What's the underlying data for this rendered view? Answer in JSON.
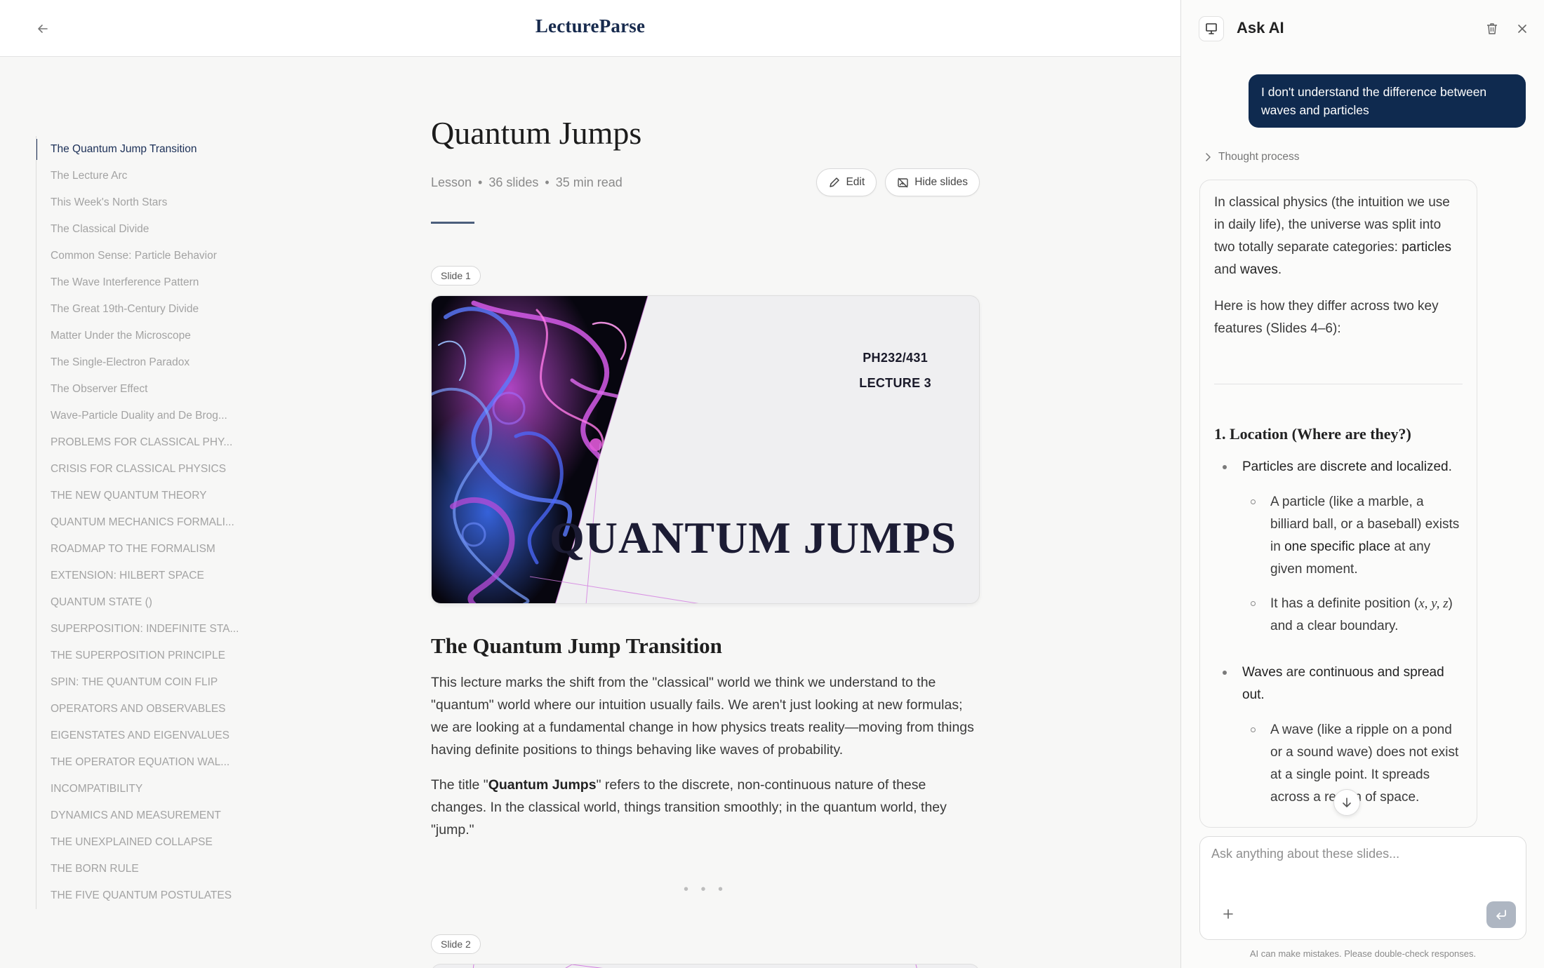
{
  "app": {
    "brand": "LectureParse"
  },
  "toc": {
    "items": [
      "The Quantum Jump Transition",
      "The Lecture Arc",
      "This Week's North Stars",
      "The Classical Divide",
      "Common Sense: Particle Behavior",
      "The Wave Interference Pattern",
      "The Great 19th-Century Divide",
      "Matter Under the Microscope",
      "The Single-Electron Paradox",
      "The Observer Effect",
      "Wave-Particle Duality and De Brog...",
      "PROBLEMS FOR CLASSICAL PHY...",
      "CRISIS FOR CLASSICAL PHYSICS",
      "THE NEW QUANTUM THEORY",
      "QUANTUM MECHANICS FORMALI...",
      "ROADMAP TO THE FORMALISM",
      "EXTENSION: HILBERT SPACE",
      "QUANTUM STATE ()",
      "SUPERPOSITION: INDEFINITE STA...",
      "THE SUPERPOSITION PRINCIPLE",
      "SPIN: THE QUANTUM COIN FLIP",
      "OPERATORS AND OBSERVABLES",
      "EIGENSTATES AND EIGENVALUES",
      "THE OPERATOR EQUATION WAL...",
      "INCOMPATIBILITY",
      "DYNAMICS AND MEASUREMENT",
      "THE UNEXPLAINED COLLAPSE",
      "THE BORN RULE",
      "THE FIVE QUANTUM POSTULATES"
    ],
    "active_index": 0
  },
  "doc": {
    "title": "Quantum Jumps",
    "meta": {
      "type": "Lesson",
      "slides": "36 slides",
      "read": "35 min read"
    },
    "edit_label": "Edit",
    "hide_slides_label": "Hide slides",
    "slide1": {
      "badge": "Slide 1",
      "code": "PH232/431",
      "lecture": "LECTURE 3",
      "title": "QUANTUM JUMPS"
    },
    "section_title": "The Quantum Jump Transition",
    "para1": "This lecture marks the shift from the \"classical\" world we think we understand to the \"quantum\" world where our intuition usually fails. We aren't just looking at new formulas; we are looking at a fundamental change in how physics treats reality—moving from things having definite positions to things behaving like waves of probability.",
    "para2_pre": "The title \"",
    "para2_bold": "Quantum Jumps",
    "para2_post": "\" refers to the discrete, non-continuous nature of these changes. In the classical world, things transition smoothly; in the quantum world, they \"jump.\"",
    "ellipsis": "• • •",
    "slide2": {
      "badge": "Slide 2"
    }
  },
  "ai": {
    "title": "Ask AI",
    "user_message": "I don't understand the difference between waves and particles",
    "thought_label": "Thought process",
    "answer": {
      "p1_a": "In classical physics (the intuition we use in daily life), the universe was split into two totally separate categories: ",
      "p1_b": "particles",
      "p1_c": " and ",
      "p1_d": "waves",
      "p1_e": ".",
      "p2": "Here is how they differ across two key features (Slides 4–6):",
      "h3": "1. Location (Where are they?)",
      "b1_a": "Particles",
      "b1_b": " are ",
      "b1_c": "discrete and localized",
      "b1_d": ".",
      "b1_s1_a": "A particle (like a marble, a billiard ball, or a baseball) exists in ",
      "b1_s1_b": "one specific place",
      "b1_s1_c": " at any given moment.",
      "b1_s2_a": "It has a definite position (",
      "b1_s2_math": "x, y, z",
      "b1_s2_b": ") and a clear boundary.",
      "b2_a": "Waves",
      "b2_b": " are ",
      "b2_c": "continuous and spread out",
      "b2_d": ".",
      "b2_s1": "A wave (like a ripple on a pond or a sound wave) does not exist at a single point. It spreads across a region of space."
    },
    "input_placeholder": "Ask anything about these slides...",
    "disclaimer": "AI can make mistakes. Please double-check responses."
  },
  "colors": {
    "accent": "#0f2a4f",
    "brand": "#172a4d",
    "send_disabled": "#aeb6c2"
  }
}
